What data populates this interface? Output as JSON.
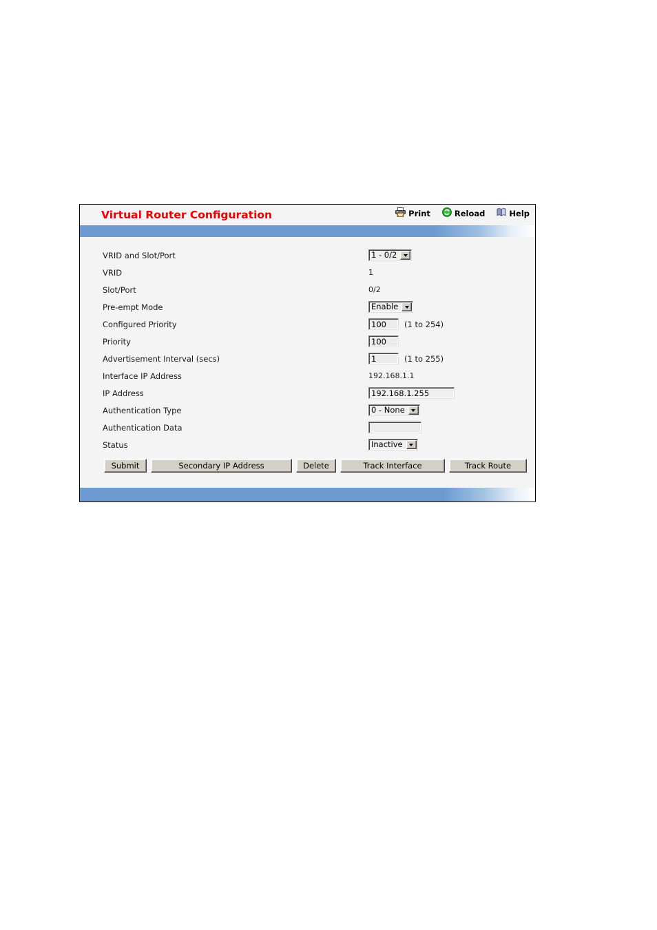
{
  "panel": {
    "title": "Virtual Router Configuration",
    "title_color": "#ee0000",
    "accent_color": "#6d9bd1",
    "background_color": "#f4f4f4"
  },
  "toolbar": {
    "print_label": "Print",
    "reload_label": "Reload",
    "help_label": "Help"
  },
  "form": {
    "rows": [
      {
        "label": "VRID and Slot/Port",
        "value": "1 - 0/2"
      },
      {
        "label": "VRID",
        "value": "1"
      },
      {
        "label": "Slot/Port",
        "value": "0/2"
      },
      {
        "label": "Pre-empt Mode",
        "value": "Enable"
      },
      {
        "label": "Configured Priority",
        "value": "100",
        "hint": "(1 to 254)"
      },
      {
        "label": "Priority",
        "value": "100"
      },
      {
        "label": "Advertisement Interval (secs)",
        "value": "1",
        "hint": "(1 to 255)"
      },
      {
        "label": "Interface IP Address",
        "value": "192.168.1.1"
      },
      {
        "label": "IP Address",
        "value": "192.168.1.255"
      },
      {
        "label": "Authentication Type",
        "value": "0 - None"
      },
      {
        "label": "Authentication Data",
        "value": ""
      },
      {
        "label": "Status",
        "value": "Inactive"
      }
    ]
  },
  "buttons": {
    "submit": "Submit",
    "secondary_ip_address": "Secondary IP Address",
    "delete": "Delete",
    "track_interface": "Track Interface",
    "track_route": "Track Route"
  }
}
